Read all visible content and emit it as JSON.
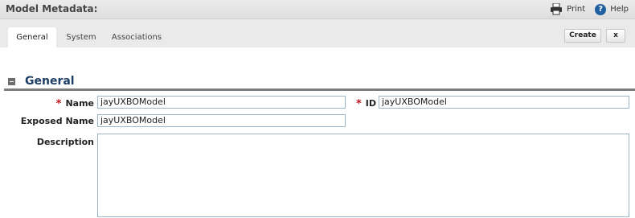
{
  "header": {
    "title": "Model Metadata:",
    "print_label": "Print",
    "help_label": "Help",
    "help_glyph": "?"
  },
  "tabs": [
    {
      "label": "General",
      "active": true
    },
    {
      "label": "System",
      "active": false
    },
    {
      "label": "Associations",
      "active": false
    }
  ],
  "actions": {
    "create_label": "Create",
    "close_label": "x"
  },
  "section": {
    "title": "General",
    "collapsed": false
  },
  "form": {
    "name_label": "Name",
    "name_value": "jayUXBOModel",
    "id_label": "ID",
    "id_value": "jayUXBOModel",
    "exposed_name_label": "Exposed Name",
    "exposed_name_value": "jayUXBOModel",
    "description_label": "Description",
    "description_value": "",
    "required_marker": "*"
  },
  "colors": {
    "section_title": "#1b3f66",
    "required": "#c0141d",
    "input_border": "#9ab6c8"
  }
}
